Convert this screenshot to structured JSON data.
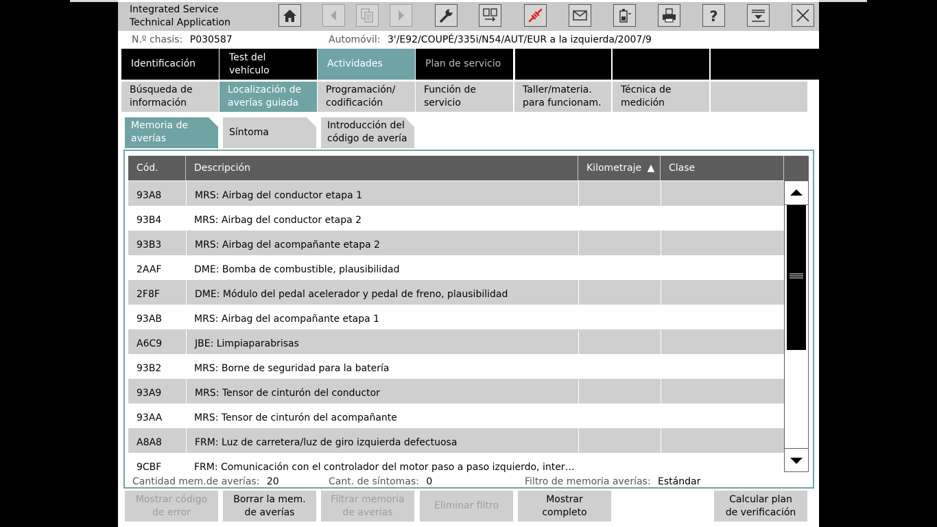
{
  "app": {
    "title_line1": "Integrated Service",
    "title_line2": "Technical Application"
  },
  "toolbar": [
    {
      "name": "home-icon",
      "enabled": true
    },
    {
      "name": "back-arrow-icon",
      "enabled": false
    },
    {
      "name": "documents-icon",
      "enabled": false
    },
    {
      "name": "forward-arrow-icon",
      "enabled": false
    },
    {
      "name": "wrench-icon",
      "enabled": true
    },
    {
      "name": "swap-connection-icon",
      "enabled": true
    },
    {
      "name": "disconnected-plug-icon",
      "enabled": true,
      "color": "#e0201b"
    },
    {
      "name": "envelope-icon",
      "enabled": true
    },
    {
      "name": "battery-icon",
      "enabled": true
    },
    {
      "name": "printer-icon",
      "enabled": true
    },
    {
      "name": "help-icon",
      "enabled": true
    },
    {
      "name": "minimize-icon",
      "enabled": true
    },
    {
      "name": "close-icon",
      "enabled": true
    }
  ],
  "info": {
    "chassis_label": "N.º chasis:",
    "chassis_value": "P030587",
    "vehicle_label": "Automóvil:",
    "vehicle_value": "3'/E92/COUPÉ/335i/N54/AUT/EUR a la izquierda/2007/9"
  },
  "main_tabs": [
    {
      "l1": "Identificación",
      "l2": ""
    },
    {
      "l1": "Test del",
      "l2": "vehículo"
    },
    {
      "l1": "Actividades",
      "l2": ""
    },
    {
      "l1": "Plan de servicio",
      "l2": ""
    }
  ],
  "sub_tabs": [
    {
      "l1": "Búsqueda de",
      "l2": "información"
    },
    {
      "l1": "Localización de",
      "l2": "averías guiada"
    },
    {
      "l1": "Programación/",
      "l2": "codificación"
    },
    {
      "l1": "Función de",
      "l2": "servicio"
    },
    {
      "l1": "Taller/materia.",
      "l2": "para funcionam."
    },
    {
      "l1": "Técnica de",
      "l2": "medición"
    }
  ],
  "third_tabs": [
    {
      "l1": "Memoria de",
      "l2": "averías"
    },
    {
      "l1": "Síntoma",
      "l2": ""
    },
    {
      "l1": "Introducción del",
      "l2": "código de avería"
    }
  ],
  "table": {
    "columns": [
      "Cód.",
      "Descripción",
      "Kilometraje",
      "Clase"
    ],
    "sort_indicator": "▲",
    "rows": [
      {
        "code": "93A8",
        "desc": "MRS: Airbag del conductor etapa 1"
      },
      {
        "code": "93B4",
        "desc": "MRS: Airbag del conductor etapa 2"
      },
      {
        "code": "93B3",
        "desc": "MRS: Airbag del acompañante etapa 2"
      },
      {
        "code": "2AAF",
        "desc": "DME: Bomba de combustible, plausibilidad"
      },
      {
        "code": "2F8F",
        "desc": "DME: Módulo del pedal acelerador y pedal de freno, plausibilidad"
      },
      {
        "code": "93AB",
        "desc": "MRS: Airbag del acompañante etapa 1"
      },
      {
        "code": "A6C9",
        "desc": "JBE: Limpiaparabrisas"
      },
      {
        "code": "93B2",
        "desc": "MRS: Borne de seguridad para la batería"
      },
      {
        "code": "93A9",
        "desc": "MRS: Tensor de cinturón del conductor"
      },
      {
        "code": "93AA",
        "desc": "MRS: Tensor de cinturón del acompañante"
      },
      {
        "code": "A8A8",
        "desc": "FRM: Luz de carretera/luz de giro izquierda defectuosa"
      },
      {
        "code": "9CBF",
        "desc": "FRM: Comunicación con el controlador del motor paso a paso izquierdo, inter…"
      }
    ]
  },
  "status": {
    "count_label": "Cantidad mem.de averías:",
    "count_value": "20",
    "symptoms_label": "Cant. de síntomas:",
    "symptoms_value": "0",
    "filter_label": "Filtro de memoria averías:",
    "filter_value": "Estándar"
  },
  "buttons": [
    {
      "l1": "Mostrar código",
      "l2": "de error",
      "enabled": false
    },
    {
      "l1": "Borrar la mem.",
      "l2": "de averías",
      "enabled": true
    },
    {
      "l1": "Filtrar memoria",
      "l2": "de averías",
      "enabled": false
    },
    {
      "l1": "Eliminar filtro",
      "l2": "",
      "enabled": false
    },
    {
      "l1": "Mostrar",
      "l2": "completo",
      "enabled": true
    },
    {
      "l1": "Calcular plan",
      "l2": "de verificación",
      "enabled": true
    }
  ]
}
